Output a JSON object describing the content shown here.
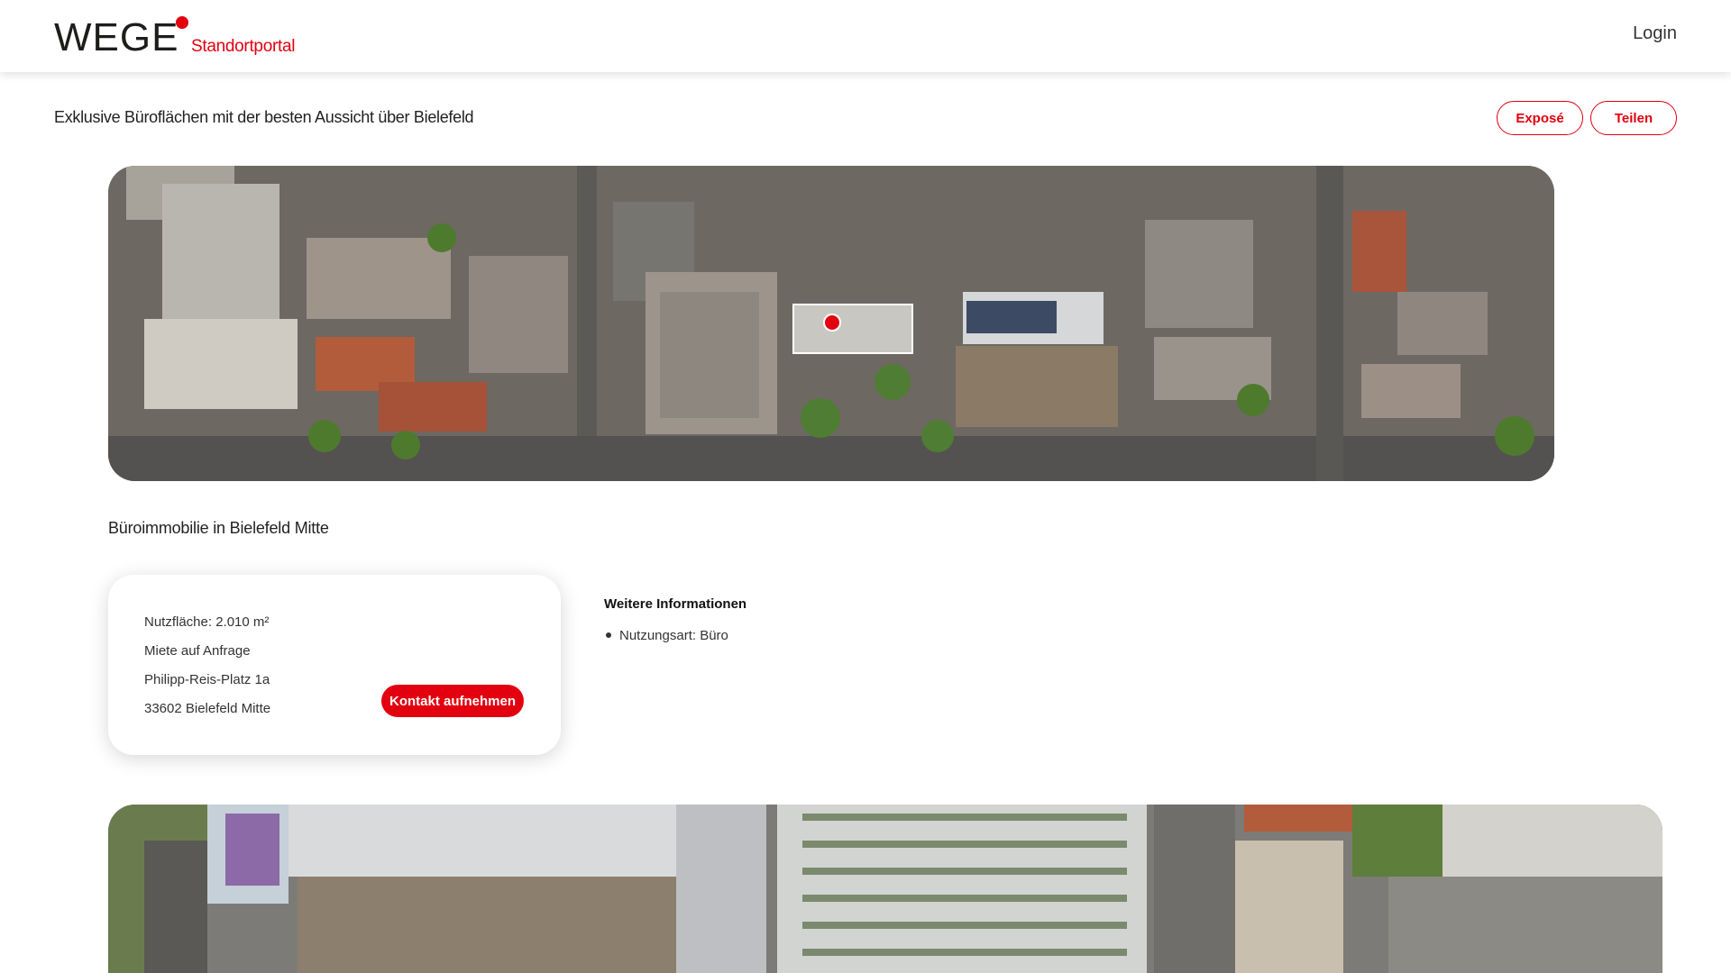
{
  "header": {
    "logo_main": "WEGE",
    "logo_sub": "Standortportal",
    "login_label": "Login"
  },
  "page": {
    "subtitle": "Exklusive Büroflächen mit der besten Aussicht über Bielefeld",
    "expose_label": "Exposé",
    "teilen_label": "Teilen",
    "property_title": "Büroimmobilie in Bielefeld Mitte"
  },
  "card": {
    "area": "Nutzfläche: 2.010 m²",
    "rent": "Miete auf Anfrage",
    "street": "Philipp-Reis-Platz 1a",
    "city": "33602 Bielefeld Mitte",
    "contact_label": "Kontakt aufnehmen"
  },
  "more": {
    "title": "Weitere Informationen",
    "items": [
      "Nutzungsart: Büro"
    ]
  },
  "colors": {
    "accent": "#e3000f"
  }
}
